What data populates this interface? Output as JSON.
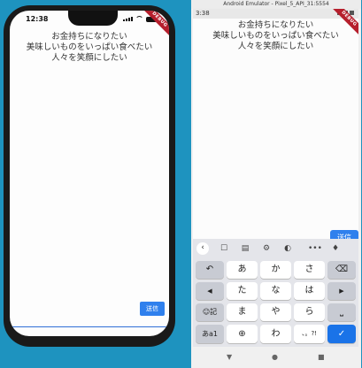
{
  "messages": [
    "お金持ちになりたい",
    "美味しいものをいっぱい食べたい",
    "人々を笑顔にしたい"
  ],
  "ios": {
    "time": "12:38",
    "send_label": "送信",
    "ribbon": "DEBUG"
  },
  "android": {
    "window_title": "Android Emulator - Pixel_5_API_31:5554",
    "time": "3:38",
    "send_label": "送信",
    "ribbon": "DEBUG",
    "keyboard": {
      "toolbar": [
        "back-icon",
        "sticker-icon",
        "clipboard-icon",
        "gear-icon",
        "palette-icon",
        "more-icon",
        "mic-icon"
      ],
      "row1": [
        "あ",
        "か",
        "さ"
      ],
      "row2": [
        "た",
        "な",
        "は"
      ],
      "row3": [
        "ま",
        "や",
        "ら"
      ],
      "row4": [
        "わ",
        "、。?!"
      ],
      "emoji_label": "☺記",
      "mode_label": "あa1",
      "undo_label": "↶"
    }
  },
  "colors": {
    "accent": "#2f80ed",
    "background": "#1e93bf",
    "debug": "#b61f2d"
  }
}
